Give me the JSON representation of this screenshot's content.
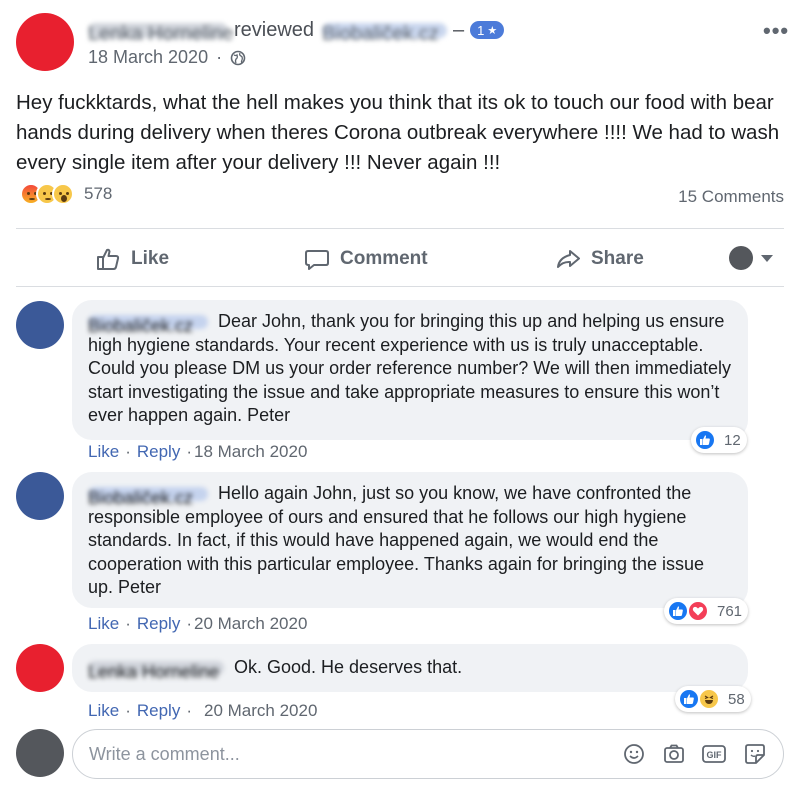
{
  "post": {
    "author_name": "Lenka Horneline",
    "reviewed_label": "reviewed",
    "page_name": "Biobaliček.cz",
    "dash": "–",
    "rating": "1",
    "rating_star": "★",
    "date": "18 March 2020",
    "date_sep": "·",
    "text": "Hey fuckktards, what the hell makes you think that its ok to touch our food with bear hands during delivery when theres Corona outbreak everywhere !!!! We had to wash every single item after your delivery !!! Never again !!!",
    "reaction_count": "578",
    "comments_count": "15 Comments",
    "reaction_icons": [
      "angry-emoji-icon",
      "sad-emoji-icon",
      "wow-emoji-icon"
    ]
  },
  "actions": {
    "like": "Like",
    "comment": "Comment",
    "share": "Share"
  },
  "comments": [
    {
      "author": "Biobaliček.cz",
      "text": "Dear John, thank you for bringing this up and helping us ensure high hygiene standards. Your recent experience with us is truly unacceptable. Could you please DM us your order reference number? We will then immediately start investigating the issue and take appropriate measures to ensure this won’t ever happen again. Peter",
      "like": "Like",
      "reply": "Reply",
      "date": "18 March 2020",
      "reaction_count": "12",
      "reaction_icons": [
        "like-reaction-icon"
      ]
    },
    {
      "author": "Biobaliček.cz",
      "text": "Hello again John, just so you know, we have confronted the responsible employee of ours and ensured that he follows our high hygiene standards. In fact, if this would have happened again, we would end the cooperation with this particular employee. Thanks again for bringing the issue up. Peter",
      "like": "Like",
      "reply": "Reply",
      "date": "20 March 2020",
      "reaction_count": "761",
      "reaction_icons": [
        "like-reaction-icon",
        "love-reaction-icon"
      ]
    },
    {
      "author": "Lenka Horneline",
      "text": "Ok. Good. He deserves that.",
      "like": "Like",
      "reply": "Reply",
      "date": "20 March 2020",
      "reaction_count": "58",
      "reaction_icons": [
        "like-reaction-icon",
        "haha-reaction-icon"
      ]
    }
  ],
  "write_comment": {
    "placeholder": "Write a comment...",
    "gif_label": "GIF"
  },
  "colors": {
    "post_author_avatar": "#e8202f",
    "page_avatar": "#3b5998",
    "current_user_avatar": "#54575c",
    "link_blue": "#4267b2",
    "bubble_bg": "#f0f2f5",
    "rating_badge": "#4c7bd9"
  }
}
